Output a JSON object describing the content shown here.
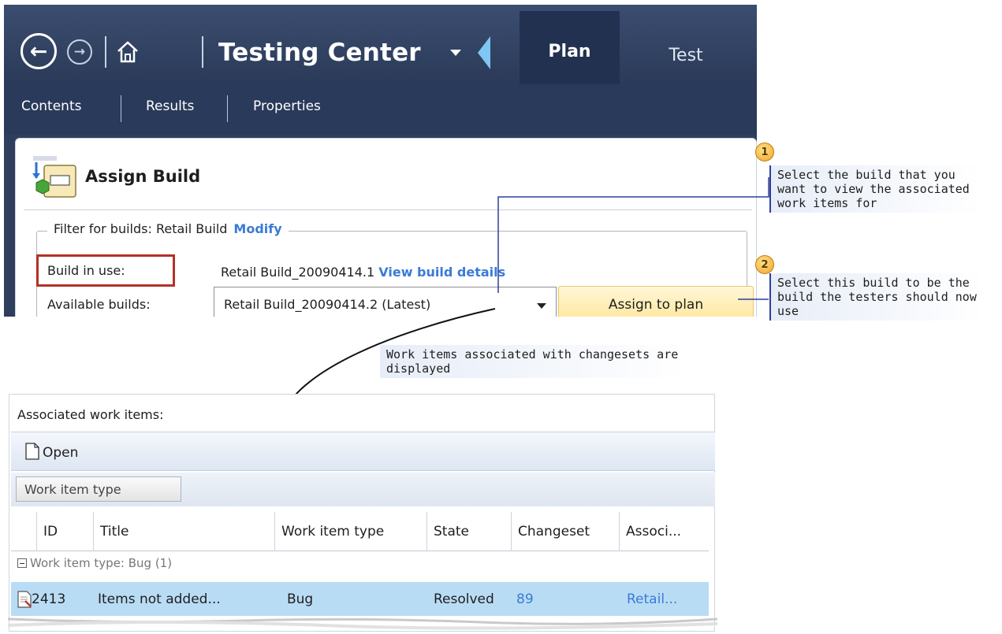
{
  "header": {
    "app_title": "Testing Center",
    "tabs": [
      {
        "label": "Plan",
        "active": true
      },
      {
        "label": "Test",
        "active": false
      }
    ],
    "subnav": [
      "Contents",
      "Results",
      "Properties"
    ]
  },
  "assign_build": {
    "title": "Assign Build",
    "filter_label": "Filter for builds: Retail Build",
    "filter_link": "Modify",
    "build_in_use_label": "Build in use:",
    "build_in_use_value": "Retail Build_20090414.1",
    "view_details_link": "View build details",
    "available_builds_label": "Available builds:",
    "available_builds_selected": "Retail Build_20090414.2 (Latest)",
    "assign_button": "Assign to plan"
  },
  "callouts": [
    {
      "number": "1",
      "text": "Select the build that you want to view the associated work items for"
    },
    {
      "number": "2",
      "text": "Select this build to be the build the testers should now use"
    },
    {
      "number": "",
      "text": "Work items associated with changesets are displayed"
    }
  ],
  "work_items": {
    "label": "Associated work items:",
    "toolbar_open": "Open",
    "group_by_chip": "Work item type",
    "columns": [
      "ID",
      "Title",
      "Work item type",
      "State",
      "Changeset",
      "Associ..."
    ],
    "group_header": "Work item type: Bug (1)",
    "rows": [
      {
        "id": "2413",
        "title": "Items not added...",
        "type": "Bug",
        "state": "Resolved",
        "changeset": "89",
        "associated": "Retail..."
      }
    ]
  },
  "colors": {
    "header_bg": "#2e3e5c",
    "accent": "#f0b820",
    "link": "#3a7bd5",
    "selected_row": "#b9dcf5",
    "highlight_border": "#b33226"
  }
}
